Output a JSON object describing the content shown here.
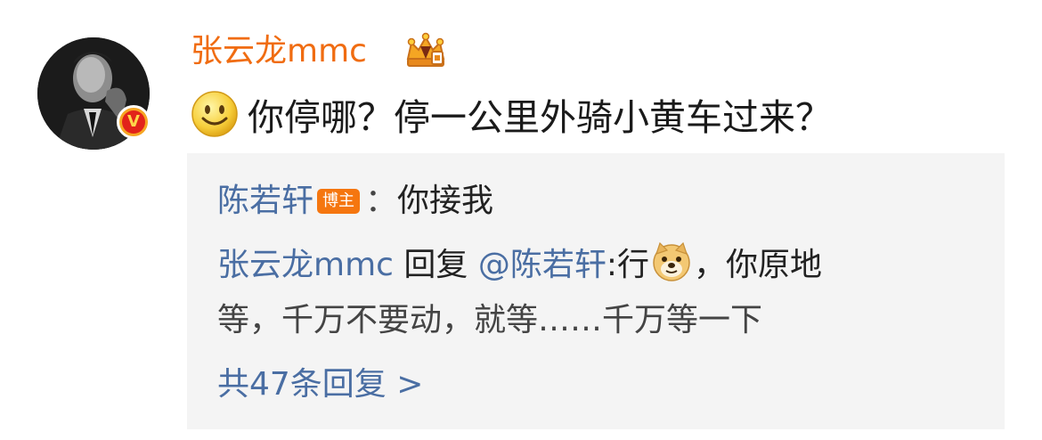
{
  "comment": {
    "author": "张云龙mmc",
    "author_badge_icon": "vip-crown-icon",
    "verified_badge": "V",
    "emoji_icon": "smile-emoji-icon",
    "text": "你停哪？停一公里外骑小黄车过来？"
  },
  "replies": [
    {
      "author": "陈若轩",
      "tag": "博主",
      "separator": "：",
      "text": "你接我"
    },
    {
      "author": "张云龙mmc",
      "action": " 回复 ",
      "mention": "@陈若轩",
      "colon": ":",
      "text_before_emoji": "行",
      "emoji_icon": "doge-emoji-icon",
      "text_after_emoji": "，你原地",
      "text_line2": "等，千万不要动，就等……千万等一下"
    }
  ],
  "more_replies": {
    "label": "共47条回复 >"
  },
  "colors": {
    "author_orange": "#f06c11",
    "link_blue": "#4a6ea3",
    "reply_bg": "#f4f4f4",
    "tag_orange": "#f5760f"
  }
}
